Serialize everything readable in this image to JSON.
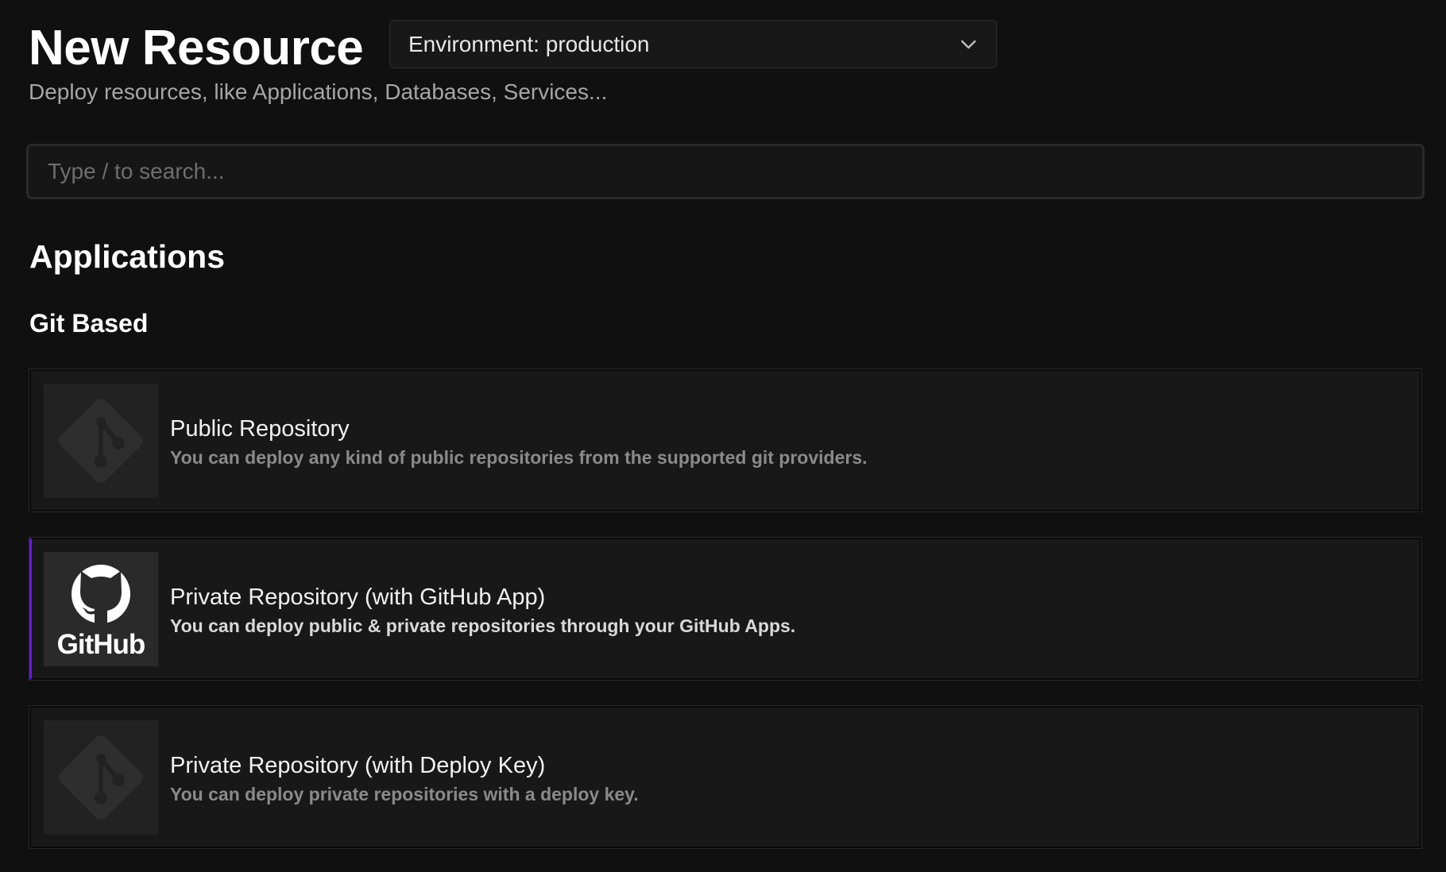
{
  "header": {
    "title": "New Resource",
    "subtitle": "Deploy resources, like Applications, Databases, Services...",
    "environment_select": {
      "value": "Environment: production",
      "icon": "chevron-down-icon"
    }
  },
  "search": {
    "placeholder": "Type / to search...",
    "value": ""
  },
  "sections": {
    "applications": {
      "title": "Applications",
      "git_based": {
        "title": "Git Based",
        "cards": [
          {
            "name": "Public Repository",
            "description": "You can deploy any kind of public repositories from the supported git providers.",
            "icon": "git-icon"
          },
          {
            "name": "Private Repository (with GitHub App)",
            "description": "You can deploy public & private repositories through your GitHub Apps.",
            "icon": "github-icon",
            "logo_text": "GitHub",
            "highlighted": true
          },
          {
            "name": "Private Repository (with Deploy Key)",
            "description": "You can deploy private repositories with a deploy key.",
            "icon": "git-icon"
          }
        ]
      }
    }
  },
  "colors": {
    "background": "#101010",
    "card_background": "#181818",
    "accent": "#6b16ed",
    "muted_text": "#a6a6a6"
  }
}
